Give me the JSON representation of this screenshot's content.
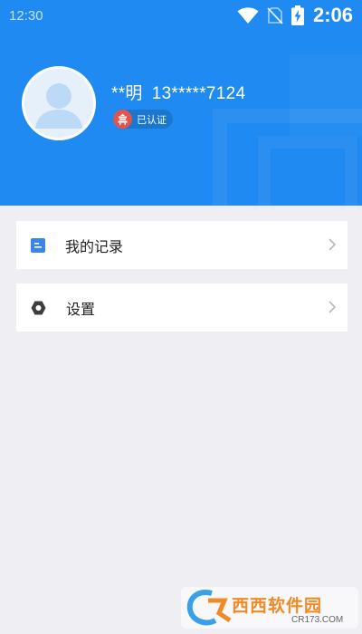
{
  "status_bar": {
    "left_time": "12:30",
    "clock": "2:06",
    "icons": [
      "wifi-icon",
      "no-sim-icon",
      "battery-charging-icon"
    ]
  },
  "profile": {
    "name": "**明",
    "phone": "13*****7124",
    "badge": "已认证",
    "avatar_icon": "default-user-avatar",
    "badge_icon": "red-seal-icon"
  },
  "menu": [
    {
      "label": "我的记录",
      "icon": "record-document-icon"
    },
    {
      "label": "设置",
      "icon": "settings-hexagon-icon"
    }
  ],
  "watermark": {
    "brand": "西西软件园",
    "domain": "CR173.COM"
  },
  "colors": {
    "header_blue": "#1f8af1",
    "page_bg": "#efeff3",
    "record_icon_blue": "#3a86e8",
    "badge_red": "#e0564e",
    "watermark_orange": "#f08a24"
  }
}
